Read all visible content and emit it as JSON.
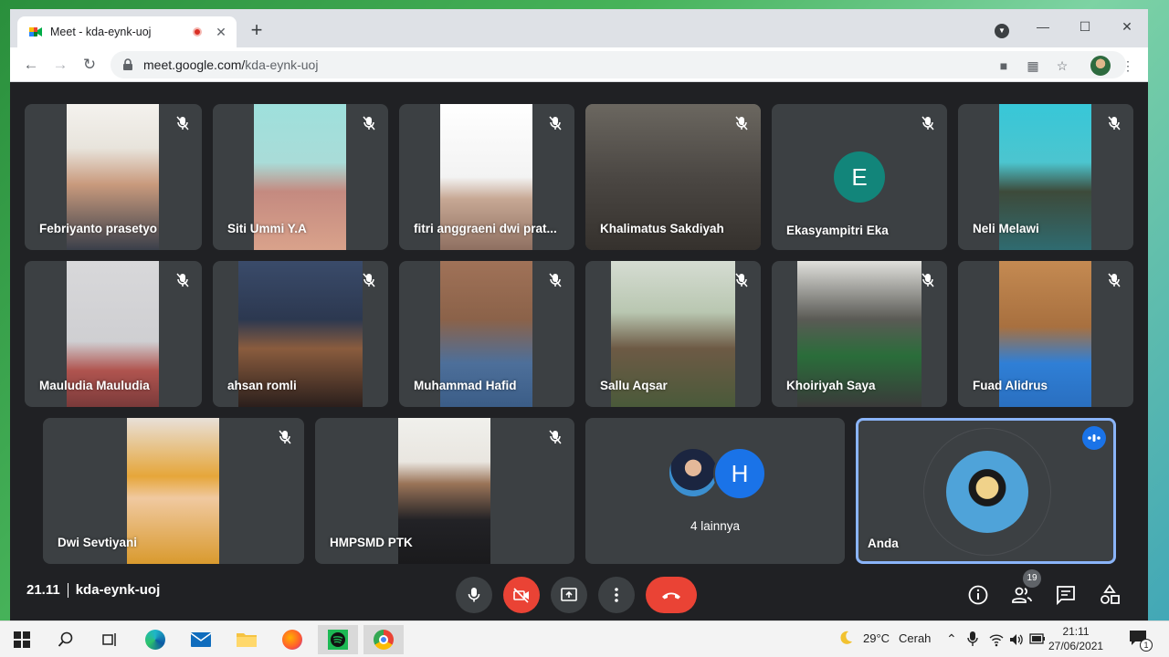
{
  "browser": {
    "tab_title": "Meet - kda-eynk-uoj",
    "tab_close": "✕",
    "new_tab": "+",
    "url_host": "meet.google.com/",
    "url_path": "kda-eynk-uoj"
  },
  "participants_row1": [
    "Febriyanto prasetyo",
    "Siti Ummi Y.A",
    "fitri anggraeni dwi prat...",
    "Khalimatus Sakdiyah",
    "Ekasyampitri Eka",
    "Neli Melawi"
  ],
  "participants_row2": [
    "Mauludia Mauludia",
    "ahsan romli",
    "Muhammad Hafid",
    "Sallu Aqsar",
    "Khoiriyah Saya",
    "Fuad Alidrus"
  ],
  "participants_row3": [
    "Dwi Sevtiyani",
    "HMPSMD PTK"
  ],
  "initial_tile": {
    "initial": "E"
  },
  "others_tile": {
    "initial": "H",
    "label": "4 lainnya"
  },
  "self_tile": {
    "label": "Anda"
  },
  "meeting": {
    "time": "21.11",
    "code": "kda-eynk-uoj",
    "people_count": "19"
  },
  "taskbar": {
    "weather_temp": "29°C",
    "weather_text": "Cerah",
    "time": "21:11",
    "date": "27/06/2021",
    "notif_count": "1"
  },
  "colors": {
    "meet_bg": "#202124",
    "tile_bg": "#3c4043",
    "hangup": "#ea4335",
    "speaking_border": "#8ab4f8",
    "initial_bg": "#12857a",
    "avatar_blue": "#1a73e8"
  }
}
